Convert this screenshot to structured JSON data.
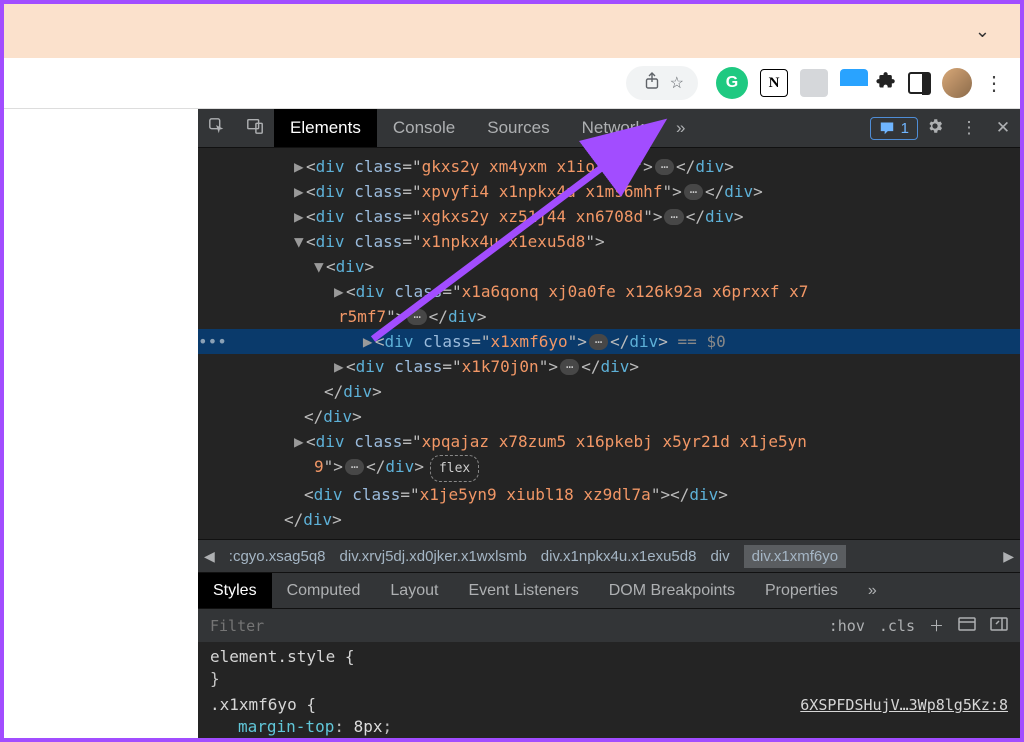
{
  "devtools": {
    "tabs": [
      "Elements",
      "Console",
      "Sources",
      "Network"
    ],
    "active_tab": "Elements",
    "issues_count": "1"
  },
  "dom": {
    "lines": [
      {
        "indent": 290,
        "tri": "▶",
        "open": "<div class=",
        "cls": "gkxs2y xm4yxm x1iorvi4",
        "close": ">",
        "ellipsis": true,
        "end": "</div>"
      },
      {
        "indent": 290,
        "tri": "▶",
        "open": "<div class=",
        "cls": "xpvyfi4 x1npkx4u x1ms6mhf",
        "close": ">",
        "ellipsis": true,
        "end": "</div>"
      },
      {
        "indent": 290,
        "tri": "▶",
        "open": "<div class=",
        "cls": "xgkxs2y xz51j44 xn6708d",
        "close": ">",
        "ellipsis": true,
        "end": "</div>"
      },
      {
        "indent": 290,
        "tri": "▼",
        "open": "<div class=",
        "cls": "x1npkx4u x1exu5d8",
        "close": ">"
      },
      {
        "indent": 310,
        "tri": "▼",
        "open": "<div>",
        "plain_open": true
      },
      {
        "indent": 330,
        "tri": "▶",
        "open": "<div class=",
        "cls": "x1a6qonq xj0a0fe x126k92a x6prxxf x7r5mf7",
        "close": ">",
        "ellipsis": true,
        "end": "</div>",
        "wrap_indent": 334
      },
      {
        "indent": 330,
        "tri": "▶",
        "open": "<div class=",
        "cls": "x1xmf6yo",
        "close": ">",
        "ellipsis": true,
        "end": "</div>",
        "selected": true,
        "eq": " == $0"
      },
      {
        "indent": 330,
        "tri": "▶",
        "open": "<div class=",
        "cls": "x1k70j0n",
        "close": ">",
        "ellipsis": true,
        "end": "</div>"
      },
      {
        "indent": 320,
        "closing": "</div>"
      },
      {
        "indent": 300,
        "closing": "</div>"
      },
      {
        "indent": 290,
        "tri": "▶",
        "open": "<div class=",
        "cls": "xpqajaz x78zum5 x16pkebj x5yr21d x1je5yn9",
        "close": ">",
        "ellipsis": true,
        "end": "</div>",
        "flex_pill": "flex",
        "wrap_indent": 310
      },
      {
        "indent": 300,
        "open2": "<div class=",
        "cls": "x1je5yn9 xiubl18 xz9dl7a",
        "close": ">",
        "end": "</div>"
      },
      {
        "indent": 280,
        "closing": "</div>"
      }
    ]
  },
  "breadcrumb": {
    "items": [
      {
        "text": ":cgyo.xsag5q8",
        "tag": ""
      },
      {
        "text": "div",
        "cls": ".xrvj5dj.xd0jker.x1wxlsmb"
      },
      {
        "text": "div",
        "cls": ".x1npkx4u.x1exu5d8"
      },
      {
        "text": "div",
        "cls": ""
      },
      {
        "text": "div",
        "cls": ".x1xmf6yo",
        "selected": true
      }
    ]
  },
  "styles": {
    "tabs": [
      "Styles",
      "Computed",
      "Layout",
      "Event Listeners",
      "DOM Breakpoints",
      "Properties"
    ],
    "active": "Styles",
    "filter_placeholder": "Filter",
    "hov": ":hov",
    "cls": ".cls",
    "element_style": "element.style {",
    "element_style_close": "}",
    "rule_selector": ".x1xmf6yo {",
    "rule_src": "6XSPFDSHujV…3Wp8lg5Kz:8",
    "rule_prop": "margin-top",
    "rule_val": "8px"
  }
}
